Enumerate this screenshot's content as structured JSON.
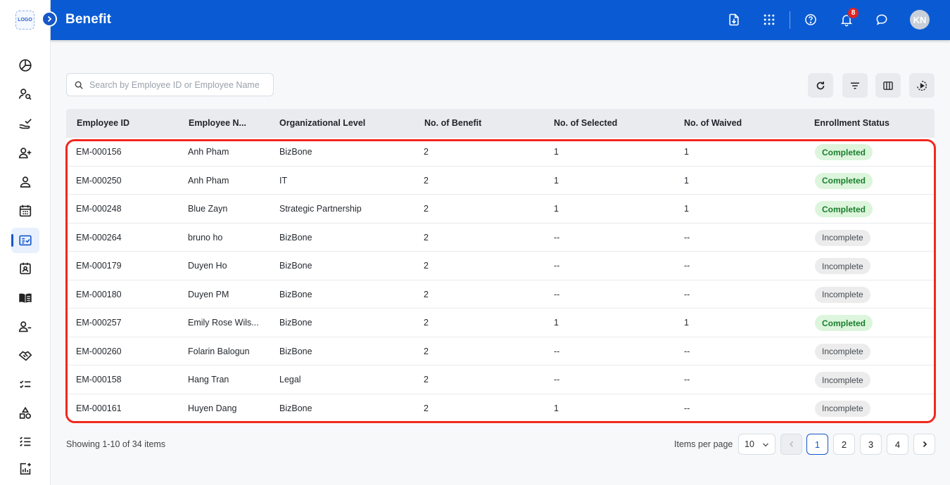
{
  "app": {
    "logo_text": "LOGO",
    "page_title": "Benefit",
    "notification_count": "8",
    "avatar_initials": "KN"
  },
  "sidebar": {
    "items": [
      {
        "icon": "pie-chart-icon"
      },
      {
        "icon": "user-search-icon"
      },
      {
        "icon": "hand-check-icon"
      },
      {
        "icon": "user-add-icon"
      },
      {
        "icon": "user-icon"
      },
      {
        "icon": "calendar-icon"
      },
      {
        "icon": "benefit-card-icon",
        "active": true
      },
      {
        "icon": "contact-card-icon"
      },
      {
        "icon": "book-icon"
      },
      {
        "icon": "user-minus-icon"
      },
      {
        "icon": "handshake-icon"
      },
      {
        "icon": "checklist-icon"
      },
      {
        "icon": "shapes-icon"
      },
      {
        "icon": "list-icon"
      },
      {
        "icon": "report-icon"
      }
    ]
  },
  "search": {
    "placeholder": "Search by Employee ID or Employee Name",
    "value": ""
  },
  "table": {
    "columns": [
      "Employee ID",
      "Employee N...",
      "Organizational Level",
      "No. of Benefit",
      "No. of Selected",
      "No. of Waived",
      "Enrollment Status"
    ],
    "rows": [
      {
        "id": "EM-000156",
        "name": "Anh Pham",
        "org": "BizBone",
        "benefit": "2",
        "selected": "1",
        "waived": "1",
        "status": "Completed"
      },
      {
        "id": "EM-000250",
        "name": "Anh Pham",
        "org": "IT",
        "benefit": "2",
        "selected": "1",
        "waived": "1",
        "status": "Completed"
      },
      {
        "id": "EM-000248",
        "name": "Blue Zayn",
        "org": "Strategic Partnership",
        "benefit": "2",
        "selected": "1",
        "waived": "1",
        "status": "Completed"
      },
      {
        "id": "EM-000264",
        "name": "bruno ho",
        "org": "BizBone",
        "benefit": "2",
        "selected": "--",
        "waived": "--",
        "status": "Incomplete"
      },
      {
        "id": "EM-000179",
        "name": "Duyen Ho",
        "org": "BizBone",
        "benefit": "2",
        "selected": "--",
        "waived": "--",
        "status": "Incomplete"
      },
      {
        "id": "EM-000180",
        "name": "Duyen PM",
        "org": "BizBone",
        "benefit": "2",
        "selected": "--",
        "waived": "--",
        "status": "Incomplete"
      },
      {
        "id": "EM-000257",
        "name": "Emily Rose Wils...",
        "org": "BizBone",
        "benefit": "2",
        "selected": "1",
        "waived": "1",
        "status": "Completed"
      },
      {
        "id": "EM-000260",
        "name": "Folarin Balogun",
        "org": "BizBone",
        "benefit": "2",
        "selected": "--",
        "waived": "--",
        "status": "Incomplete"
      },
      {
        "id": "EM-000158",
        "name": "Hang Tran",
        "org": "Legal",
        "benefit": "2",
        "selected": "--",
        "waived": "--",
        "status": "Incomplete"
      },
      {
        "id": "EM-000161",
        "name": "Huyen Dang",
        "org": "BizBone",
        "benefit": "2",
        "selected": "1",
        "waived": "--",
        "status": "Incomplete"
      }
    ]
  },
  "footer": {
    "showing": "Showing 1-10 of 34 items",
    "items_per_page_label": "Items per page",
    "items_per_page_value": "10",
    "pages": [
      "1",
      "2",
      "3",
      "4"
    ],
    "current_page": "1"
  },
  "colors": {
    "header": "#0a5bd3",
    "completed_bg": "#dcf5dc",
    "completed_text": "#1a7f2c",
    "incomplete_bg": "#ececec",
    "highlight": "#f2281e"
  }
}
